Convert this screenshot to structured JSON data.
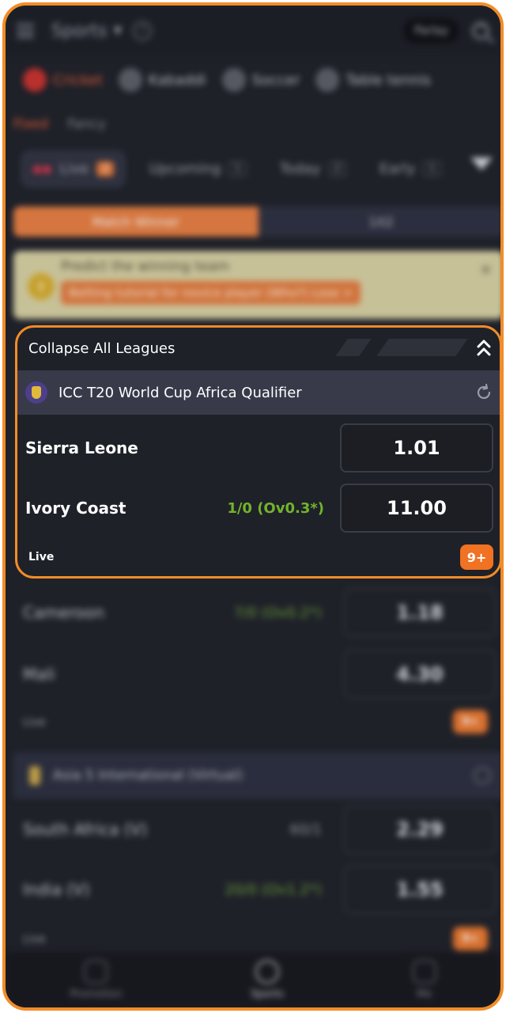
{
  "header": {
    "title": "Sports",
    "parlay": "Parlay"
  },
  "sports": [
    {
      "label": "Cricket",
      "active": true
    },
    {
      "label": "Kabaddi"
    },
    {
      "label": "Soccer"
    },
    {
      "label": "Table tennis"
    }
  ],
  "subtabs": [
    "Fixed",
    "Fancy"
  ],
  "filters": [
    {
      "label": "Live",
      "count": "2"
    },
    {
      "label": "Upcoming",
      "count": "1"
    },
    {
      "label": "Today",
      "count": "2"
    },
    {
      "label": "Early",
      "count": "1"
    }
  ],
  "market": {
    "left": "Match Winner",
    "right": "1X2"
  },
  "tip": {
    "title": "Predict the winning team",
    "link": "Betting tutorial for novice player (Who?) Lose >"
  },
  "focus": {
    "collapse_label": "Collapse All Leagues",
    "league": "ICC T20 World Cup Africa Qualifier",
    "team1": {
      "name": "Sierra Leone",
      "odd": "1.01"
    },
    "team2": {
      "name": "Ivory Coast",
      "score": "1/0 (Ov0.3*)",
      "odd": "11.00"
    },
    "status": "Live",
    "more": "9+"
  },
  "blur_matches": [
    {
      "name": "Cameroon",
      "score": "7/0 (Ov0.2*)",
      "odd": "1.18"
    },
    {
      "name": "Mali",
      "score": "",
      "odd": "4.30"
    },
    {
      "status": "Live",
      "more": "9+"
    },
    {
      "league": "Asia 5 International (Virtual)"
    },
    {
      "name": "South Africa (V)",
      "score": "60/1",
      "odd": "2.29"
    },
    {
      "name": "India (V)",
      "score": "20/0 (Ov1.2*)",
      "odd": "1.55"
    },
    {
      "status": "Live",
      "more": "9+"
    }
  ],
  "nav": [
    {
      "label": "Promotion"
    },
    {
      "label": "Sports",
      "active": true
    },
    {
      "label": "Me"
    }
  ]
}
